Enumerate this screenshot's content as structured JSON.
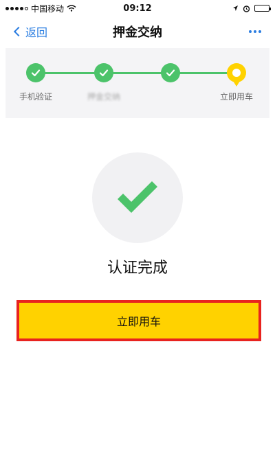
{
  "status_bar": {
    "carrier": "中国移动",
    "time": "09:12"
  },
  "nav": {
    "back_label": "返回",
    "title": "押金交纳"
  },
  "steps": [
    {
      "label": "手机验证",
      "state": "done"
    },
    {
      "label": "押金交纳",
      "state": "done"
    },
    {
      "label": "",
      "state": "done"
    },
    {
      "label": "立即用车",
      "state": "current"
    }
  ],
  "main": {
    "status_title": "认证完成",
    "cta_label": "立即用车"
  },
  "colors": {
    "accent_green": "#4cc36a",
    "accent_yellow": "#ffd200",
    "highlight_red": "#e8231f",
    "link_blue": "#2a7de1"
  }
}
